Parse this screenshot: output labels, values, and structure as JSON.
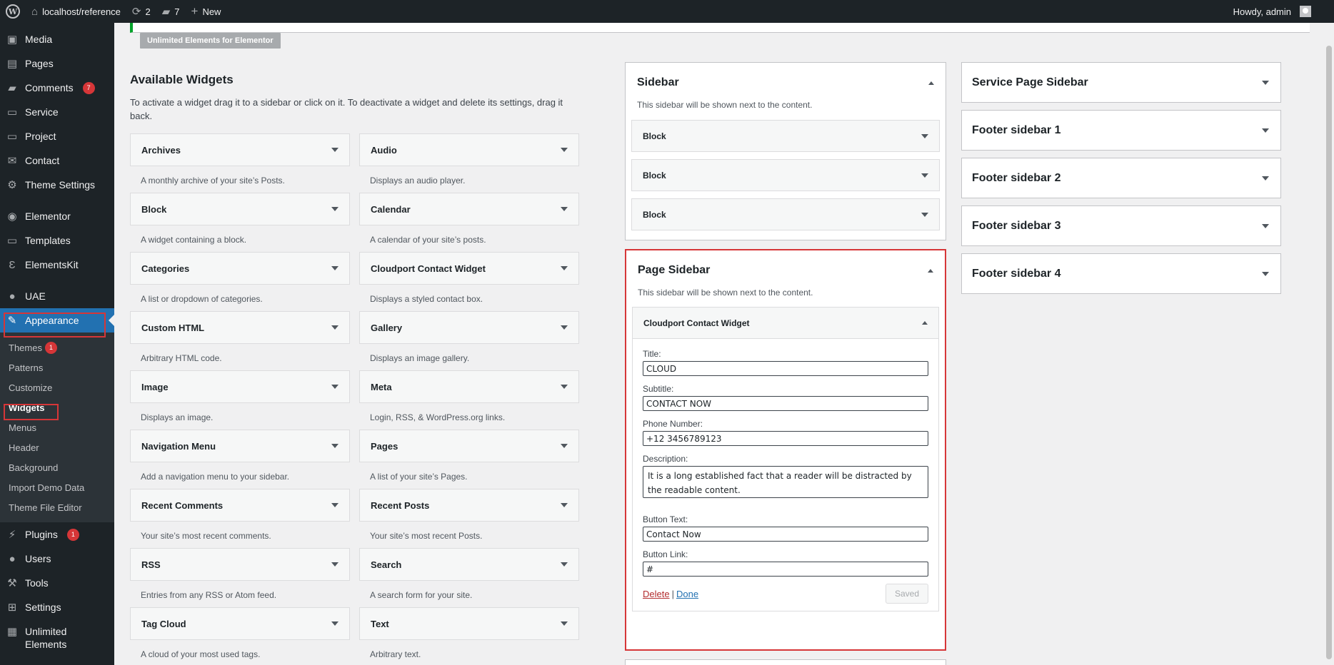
{
  "adminbar": {
    "site": "localhost/reference",
    "updates": "2",
    "comments": "7",
    "new": "New",
    "howdy": "Howdy, admin"
  },
  "menu": {
    "media": "Media",
    "pages": "Pages",
    "comments": "Comments",
    "comments_badge": "7",
    "service": "Service",
    "project": "Project",
    "contact": "Contact",
    "theme_settings": "Theme Settings",
    "elementor": "Elementor",
    "templates": "Templates",
    "elementskit": "ElementsKit",
    "uae": "UAE",
    "appearance": "Appearance",
    "sub": {
      "themes": "Themes",
      "themes_badge": "1",
      "patterns": "Patterns",
      "customize": "Customize",
      "widgets": "Widgets",
      "menus": "Menus",
      "header": "Header",
      "background": "Background",
      "import_demo": "Import Demo Data",
      "theme_file_editor": "Theme File Editor"
    },
    "plugins": "Plugins",
    "plugins_badge": "1",
    "users": "Users",
    "tools": "Tools",
    "settings": "Settings",
    "unlimited_1": "Unlimited",
    "unlimited_2": "Elements"
  },
  "notice_button": "Unlimited Elements for Elementor",
  "available": {
    "title": "Available Widgets",
    "desc": "To activate a widget drag it to a sidebar or click on it. To deactivate a widget and delete its settings, drag it back.",
    "widgets": [
      {
        "name": "Archives",
        "desc": "A monthly archive of your site’s Posts."
      },
      {
        "name": "Audio",
        "desc": "Displays an audio player."
      },
      {
        "name": "Block",
        "desc": "A widget containing a block."
      },
      {
        "name": "Calendar",
        "desc": "A calendar of your site’s posts."
      },
      {
        "name": "Categories",
        "desc": "A list or dropdown of categories."
      },
      {
        "name": "Cloudport Contact Widget",
        "desc": "Displays a styled contact box."
      },
      {
        "name": "Custom HTML",
        "desc": "Arbitrary HTML code."
      },
      {
        "name": "Gallery",
        "desc": "Displays an image gallery."
      },
      {
        "name": "Image",
        "desc": "Displays an image."
      },
      {
        "name": "Meta",
        "desc": "Login, RSS, & WordPress.org links."
      },
      {
        "name": "Navigation Menu",
        "desc": "Add a navigation menu to your sidebar."
      },
      {
        "name": "Pages",
        "desc": "A list of your site’s Pages."
      },
      {
        "name": "Recent Comments",
        "desc": "Your site’s most recent comments."
      },
      {
        "name": "Recent Posts",
        "desc": "Your site’s most recent Posts."
      },
      {
        "name": "RSS",
        "desc": "Entries from any RSS or Atom feed."
      },
      {
        "name": "Search",
        "desc": "A search form for your site."
      },
      {
        "name": "Tag Cloud",
        "desc": "A cloud of your most used tags."
      },
      {
        "name": "Text",
        "desc": "Arbitrary text."
      }
    ]
  },
  "sidebar": {
    "title": "Sidebar",
    "desc": "This sidebar will be shown next to the content.",
    "widgets": [
      "Block",
      "Block",
      "Block"
    ]
  },
  "page_sidebar": {
    "title": "Page Sidebar",
    "desc": "This sidebar will be shown next to the content.",
    "widget_title": "Cloudport Contact Widget",
    "form": {
      "title_label": "Title:",
      "title_value": "CLOUD",
      "subtitle_label": "Subtitle:",
      "subtitle_value": "CONTACT NOW",
      "phone_label": "Phone Number:",
      "phone_value": "+12 3456789123",
      "desc_label": "Description:",
      "desc_value": "It is a long established fact that a reader will be distracted by the readable content.",
      "btn_text_label": "Button Text:",
      "btn_text_value": "Contact Now",
      "btn_link_label": "Button Link:",
      "btn_link_value": "#",
      "delete": "Delete",
      "separator": "|",
      "done": "Done",
      "saved": "Saved"
    }
  },
  "right_sidebars": [
    "Service Page Sidebar",
    "Footer sidebar 1",
    "Footer sidebar 2",
    "Footer sidebar 3",
    "Footer sidebar 4"
  ],
  "colors": {
    "highlight": "#d63638",
    "admin_dark": "#1d2327",
    "accent": "#2271b1"
  }
}
